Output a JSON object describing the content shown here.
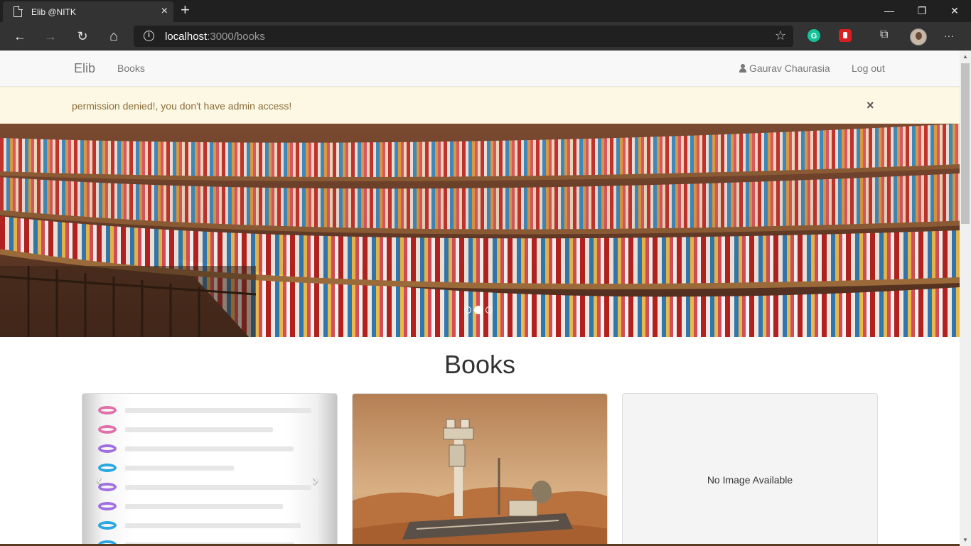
{
  "browser": {
    "tab_title": "Elib @NITK",
    "tab_close": "×",
    "new_tab": "+",
    "url_host": "localhost",
    "url_path": ":3000/books",
    "window_minimize": "—",
    "window_maximize": "❐",
    "window_close": "✕",
    "back": "←",
    "forward": "→",
    "refresh": "↻",
    "home": "⌂",
    "favorite": "☆",
    "collections": "⧉",
    "more": "···"
  },
  "navbar": {
    "brand": "Elib",
    "books_link": "Books",
    "user_name": "Gaurav Chaurasia",
    "logout": "Log out"
  },
  "alert": {
    "message": "permission denied!, you don't have admin access!",
    "close": "×"
  },
  "carousel": {
    "slide_count": 3,
    "active_index": 1,
    "prev": "‹",
    "next": "›"
  },
  "main": {
    "heading": "Books",
    "cards": [
      {
        "image": "colorful list illustration"
      },
      {
        "image": "mars rover"
      },
      {
        "image_text": "No Image Available"
      }
    ]
  },
  "colors": {
    "alert_bg": "#fcf8e3",
    "alert_text": "#8a6d3b",
    "navbar_bg": "#f8f8f8",
    "chrome_bg": "#202020"
  }
}
